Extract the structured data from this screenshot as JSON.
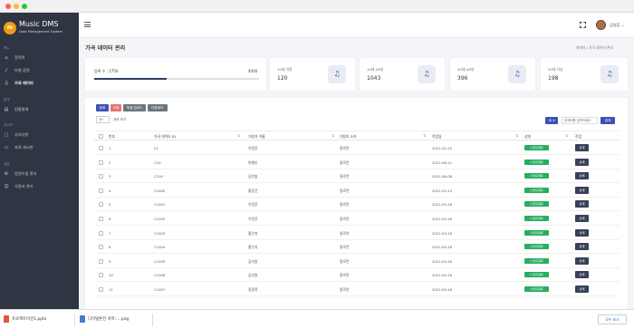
{
  "app": {
    "logo_text": "m",
    "brand": "Music DMS",
    "brand_sub": "Data Management System"
  },
  "colors": {
    "sidebar_bg": "#2f3542",
    "primary": "#3f51b5",
    "success": "#27ae60",
    "danger": "#e57373",
    "secondary": "#6c757d",
    "dark_button": "#37415a"
  },
  "sidebar": {
    "sections": [
      {
        "label": "메뉴",
        "items": [
          {
            "label": "정적목",
            "icon": "home-icon",
            "active": false
          },
          {
            "label": "보컬 음원",
            "icon": "mic-icon",
            "active": false
          },
          {
            "label": "가곡 데이터",
            "icon": "music-icon",
            "active": true
          }
        ]
      },
      {
        "label": "통계",
        "items": [
          {
            "label": "현황통계",
            "icon": "chart-icon",
            "active": false
          }
        ]
      },
      {
        "label": "게시판",
        "items": [
          {
            "label": "공지사항",
            "icon": "notice-icon",
            "active": false
          },
          {
            "label": "자료 게시판",
            "icon": "doc-icon",
            "active": false
          }
        ]
      },
      {
        "label": "설정",
        "items": [
          {
            "label": "음원수집 관리",
            "icon": "gear-icon",
            "active": false
          },
          {
            "label": "사용자 관리",
            "icon": "user-icon",
            "active": false
          }
        ]
      }
    ]
  },
  "header": {
    "fullscreen_icon": "fullscreen-icon",
    "user_name": "김영훈"
  },
  "page": {
    "title": "가곡 데이터 관리",
    "breadcrumb": "데이터 / 가곡 데이터 관리"
  },
  "stats": {
    "registered": {
      "label": "등록 수 : 1756",
      "total": "4000",
      "progress": 0.44
    },
    "cards": [
      {
        "label": "10대 이전",
        "value": "120",
        "icon": "music-note-icon"
      },
      {
        "label": "10대-20대",
        "value": "1043",
        "icon": "music-note-icon"
      },
      {
        "label": "20대-40대",
        "value": "396",
        "icon": "music-note-icon"
      },
      {
        "label": "50대 이상",
        "value": "198",
        "icon": "music-note-icon"
      }
    ]
  },
  "toolbar": {
    "buttons": [
      {
        "label": "등록",
        "color": "#3f51b5"
      },
      {
        "label": "삭제",
        "color": "#e57373"
      },
      {
        "label": "엑셀 업로드",
        "color": "#6c757d"
      },
      {
        "label": "다운로드",
        "color": "#6c757d"
      }
    ],
    "page_length": "10",
    "page_length_text": "개씩 보기",
    "search_field": "ID",
    "search_placeholder": "검색어를 입력하세요",
    "search_button": "검색"
  },
  "table": {
    "columns": [
      "번호",
      "가곡 데이터 ID",
      "가창자 이름",
      "가창자 소속",
      "작업일",
      "상태",
      "작업"
    ],
    "status_label": "✔검수완료",
    "action_label": "상세",
    "rows": [
      {
        "no": "1",
        "id": "C1",
        "name": "이정윤",
        "org": "필로먼",
        "date": "2021-02-12"
      },
      {
        "no": "2",
        "id": "C10",
        "name": "박예인",
        "org": "필로먼",
        "date": "2021-06-11"
      },
      {
        "no": "3",
        "id": "C100",
        "name": "김한솔",
        "org": "필로먼",
        "date": "2021-06-08"
      },
      {
        "no": "4",
        "id": "C1000",
        "name": "황동진",
        "org": "필로먼",
        "date": "2021-02-14"
      },
      {
        "no": "5",
        "id": "C1001",
        "name": "이정윤",
        "org": "필로먼",
        "date": "2021-09-16"
      },
      {
        "no": "6",
        "id": "C1002",
        "name": "이정윤",
        "org": "필로먼",
        "date": "2021-09-16"
      },
      {
        "no": "7",
        "id": "C1003",
        "name": "황인지",
        "org": "필로먼",
        "date": "2021-03-16"
      },
      {
        "no": "8",
        "id": "C1004",
        "name": "황인지",
        "org": "필로먼",
        "date": "2021-09-16"
      },
      {
        "no": "9",
        "id": "C1005",
        "name": "김지원",
        "org": "필로먼",
        "date": "2021-09-16"
      },
      {
        "no": "10",
        "id": "C1006",
        "name": "김지원",
        "org": "필로먼",
        "date": "2021-09-16"
      },
      {
        "no": "11",
        "id": "C1007",
        "name": "정정학",
        "org": "필로먼",
        "date": "2021-09-16"
      }
    ]
  },
  "downloads": {
    "items": [
      {
        "label": "프로젝트이전1.pptx",
        "color": "#e4572e"
      },
      {
        "label": "디지털혼전 자막-....png",
        "color": "#4a7bd0"
      }
    ],
    "show_all": "모두 표시"
  }
}
